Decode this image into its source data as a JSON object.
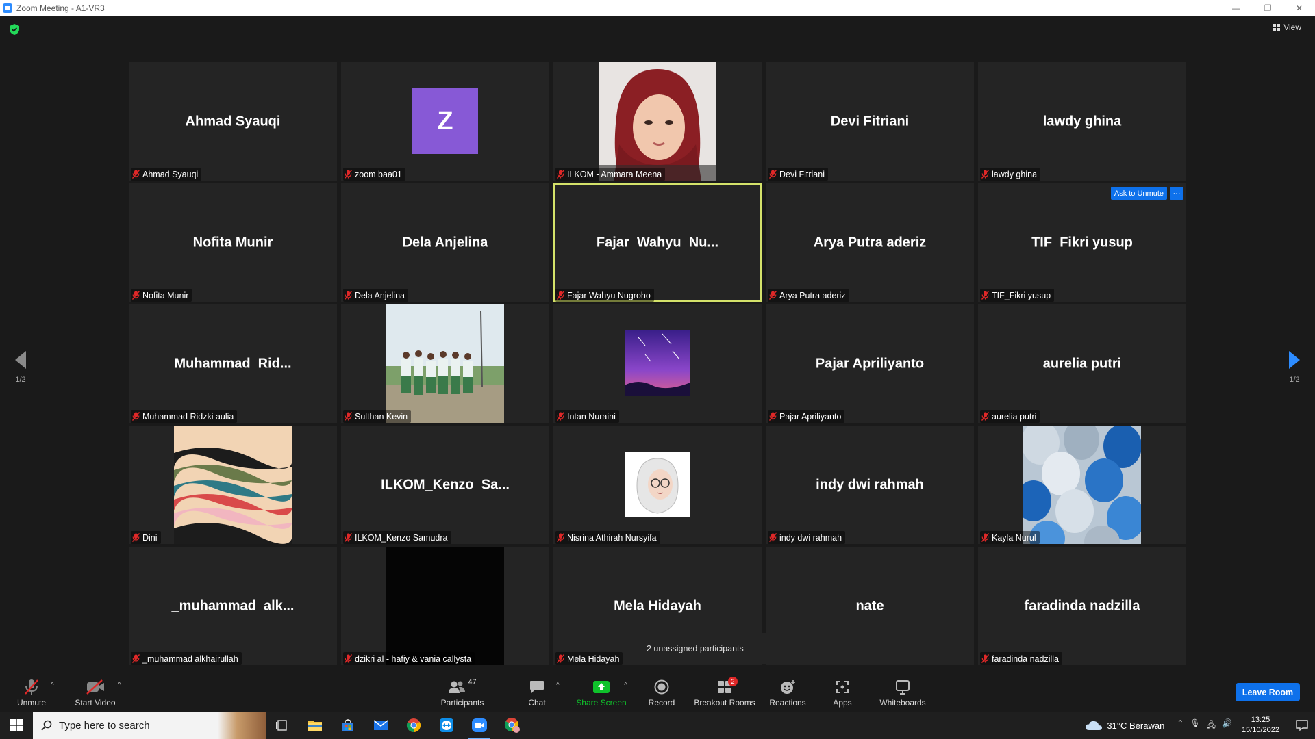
{
  "window": {
    "title": "Zoom Meeting - A1-VR3",
    "minimize": "—",
    "restore": "❐",
    "close": "✕"
  },
  "view_label": "View",
  "tiles": [
    {
      "big": "Ahmad Syauqi",
      "label": "Ahmad Syauqi",
      "kind": "name"
    },
    {
      "big": "Z",
      "label": "zoom baa01",
      "kind": "avatar"
    },
    {
      "big": "",
      "label": "ILKOM - Ammara Meena",
      "kind": "photo-hijab"
    },
    {
      "big": "Devi Fitriani",
      "label": "Devi Fitriani",
      "kind": "name"
    },
    {
      "big": "lawdy ghina",
      "label": "lawdy ghina",
      "kind": "name"
    },
    {
      "big": "Nofita Munir",
      "label": "Nofita Munir",
      "kind": "name"
    },
    {
      "big": "Dela Anjelina",
      "label": "Dela Anjelina",
      "kind": "name"
    },
    {
      "big": "Fajar  Wahyu  Nu...",
      "label": "Fajar Wahyu Nugroho",
      "kind": "name",
      "active": true
    },
    {
      "big": "Arya Putra aderiz",
      "label": "Arya Putra aderiz",
      "kind": "name"
    },
    {
      "big": "TIF_Fikri yusup",
      "label": "TIF_Fikri yusup",
      "kind": "name",
      "ask": true
    },
    {
      "big": "Muhammad  Rid...",
      "label": "Muhammad Ridzki aulia",
      "kind": "name"
    },
    {
      "big": "",
      "label": "Sulthan Kevin",
      "kind": "photo-field"
    },
    {
      "big": "",
      "label": "Intan Nuraini",
      "kind": "photo-sky"
    },
    {
      "big": "Pajar Apriliyanto",
      "label": "Pajar Apriliyanto",
      "kind": "name"
    },
    {
      "big": "aurelia putri",
      "label": "aurelia putri",
      "kind": "name"
    },
    {
      "big": "",
      "label": "Dini",
      "kind": "photo-waves"
    },
    {
      "big": "ILKOM_Kenzo  Sa...",
      "label": "ILKOM_Kenzo Samudra",
      "kind": "name"
    },
    {
      "big": "",
      "label": "Nisrina Athirah Nursyifa",
      "kind": "photo-cartoon"
    },
    {
      "big": "indy dwi rahmah",
      "label": "indy dwi rahmah",
      "kind": "name"
    },
    {
      "big": "",
      "label": "Kayla Nurul",
      "kind": "photo-balloons"
    },
    {
      "big": "_muhammad  alk...",
      "label": "_muhammad alkhairullah",
      "kind": "name"
    },
    {
      "big": "",
      "label": "dzikri al - hafiy & vania callysta",
      "kind": "photo-black"
    },
    {
      "big": "Mela Hidayah",
      "label": "Mela Hidayah",
      "kind": "name"
    },
    {
      "big": "nate",
      "label": "",
      "kind": "name"
    },
    {
      "big": "faradinda nadzilla",
      "label": "faradinda nadzilla",
      "kind": "name"
    }
  ],
  "ask_unmute": "Ask to Unmute",
  "ask_more": "···",
  "page_indicator": "1/2",
  "toast": "2 unassigned participants",
  "toolbar": {
    "unmute": "Unmute",
    "start_video": "Start Video",
    "participants": "Participants",
    "participant_count": "47",
    "chat": "Chat",
    "share_screen": "Share Screen",
    "record": "Record",
    "breakout_rooms": "Breakout Rooms",
    "breakout_badge": "2",
    "reactions": "Reactions",
    "apps": "Apps",
    "whiteboards": "Whiteboards",
    "leave": "Leave Room",
    "caret": "^"
  },
  "taskbar": {
    "search_placeholder": "Type here to search",
    "weather": "31°C  Berawan",
    "time": "13:25",
    "date": "15/10/2022"
  }
}
